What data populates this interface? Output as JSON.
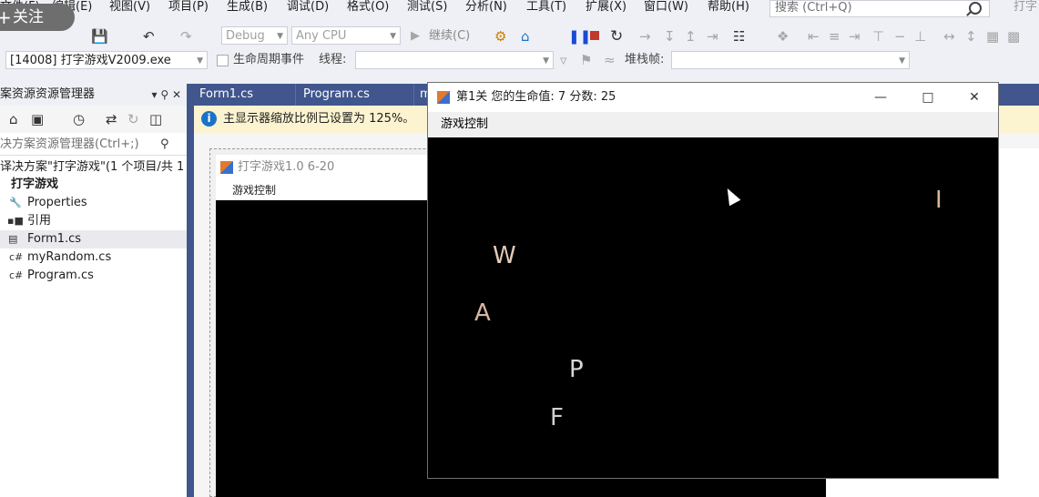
{
  "menubar": {
    "items": [
      "文件(F)",
      "编辑(E)",
      "视图(V)",
      "项目(P)",
      "生成(B)",
      "调试(D)",
      "格式(O)",
      "测试(S)",
      "分析(N)",
      "工具(T)",
      "扩展(X)",
      "窗口(W)",
      "帮助(H)"
    ],
    "search_placeholder": "搜索 (Ctrl+Q)",
    "right_hint": "打字"
  },
  "overlay": {
    "plus": "+",
    "follow_label": "关注"
  },
  "toolbar": {
    "config": "Debug",
    "platform": "Any CPU",
    "continue_label": "继续(C)",
    "process": "[14008] 打字游戏V2009.exe",
    "lifecycle_label": "生命周期事件",
    "thread_label": "线程:",
    "stackframe_label": "堆栈帧:"
  },
  "solution_explorer": {
    "title": "案资源资源管理器",
    "search_placeholder": "决方案资源管理器(Ctrl+;)",
    "solution_line": "译决方案\"打字游戏\"(1 个项目/共 1 个",
    "project": "打字游戏",
    "items": [
      {
        "label": "Properties",
        "icon": "wrench-icon"
      },
      {
        "label": "引用",
        "icon": "references-icon"
      },
      {
        "label": "Form1.cs",
        "icon": "form-icon"
      },
      {
        "label": "myRandom.cs",
        "icon": "csharp-file-icon"
      },
      {
        "label": "Program.cs",
        "icon": "csharp-file-icon"
      }
    ]
  },
  "editor_tabs": [
    "Form1.cs",
    "Program.cs",
    "m"
  ],
  "infobar": {
    "message": "主显示器缩放比例已设置为 125%。"
  },
  "designer": {
    "form_title": "打字游戏1.0 6-20",
    "menu_label": "游戏控制"
  },
  "game_window": {
    "title": "第1关 您的生命值: 7 分数: 25",
    "menu_label": "游戏控制",
    "letters": [
      {
        "char": "W",
        "color": "#e3cab8"
      },
      {
        "char": "A",
        "color": "#d9b79f"
      },
      {
        "char": "P",
        "color": "#d8d8d8"
      },
      {
        "char": "F",
        "color": "#d0d0d0"
      },
      {
        "char": "I",
        "color": "#d9b79f"
      }
    ]
  },
  "colors": {
    "vs_blue": "#40568d",
    "info_blue": "#1a73c9",
    "infobar_bg": "#fcf3d0"
  }
}
